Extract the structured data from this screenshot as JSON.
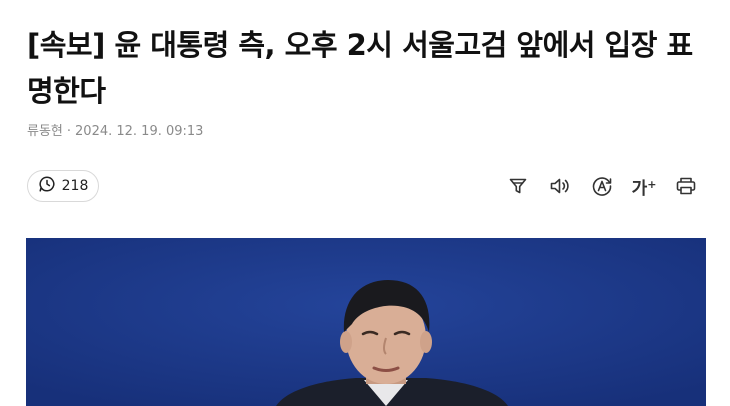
{
  "article": {
    "headline": "[속보] 윤 대통령 측, 오후 2시 서울고검 앞에서 입장 표명한다",
    "author": "류동현",
    "separator": "·",
    "date": "2024. 12. 19. 09:13"
  },
  "actions": {
    "comment_count": "218",
    "icons": [
      "filter-icon",
      "speaker-icon",
      "translate-icon",
      "font-size-icon",
      "print-icon"
    ],
    "font_size_label": "가",
    "font_size_sup": "+"
  },
  "photo": {
    "background": "#1c3888"
  }
}
